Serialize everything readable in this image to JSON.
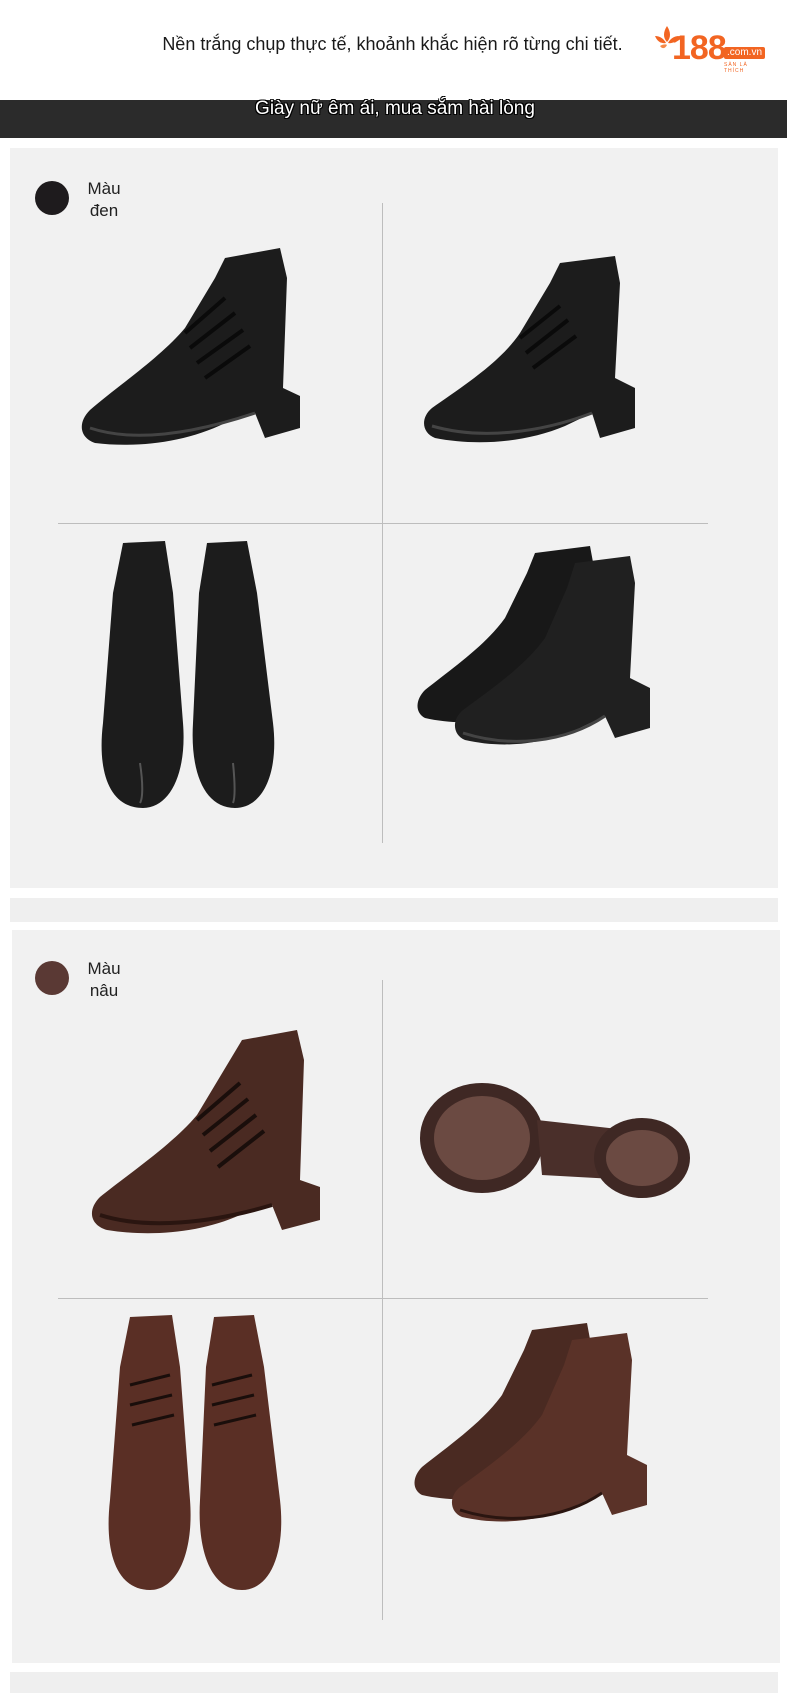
{
  "header": {
    "caption": "Nền trắng chụp thực tế, khoảnh khắc hiện rõ từng chi tiết.",
    "logo": {
      "number": "188",
      "domain": ".com.vn",
      "tagline": "SÀN LÀ THÍCH"
    }
  },
  "banner": {
    "text": "Giày nữ êm ái, mua sắm hài lòng"
  },
  "colors": {
    "accent": "#f26522",
    "black_swatch": "#1e1b1d",
    "brown_swatch": "#5a3934"
  },
  "variants": [
    {
      "label": "Màu đen",
      "swatch_color": "#1e1b1d"
    },
    {
      "label": "Màu nâu",
      "swatch_color": "#5a3934"
    }
  ]
}
